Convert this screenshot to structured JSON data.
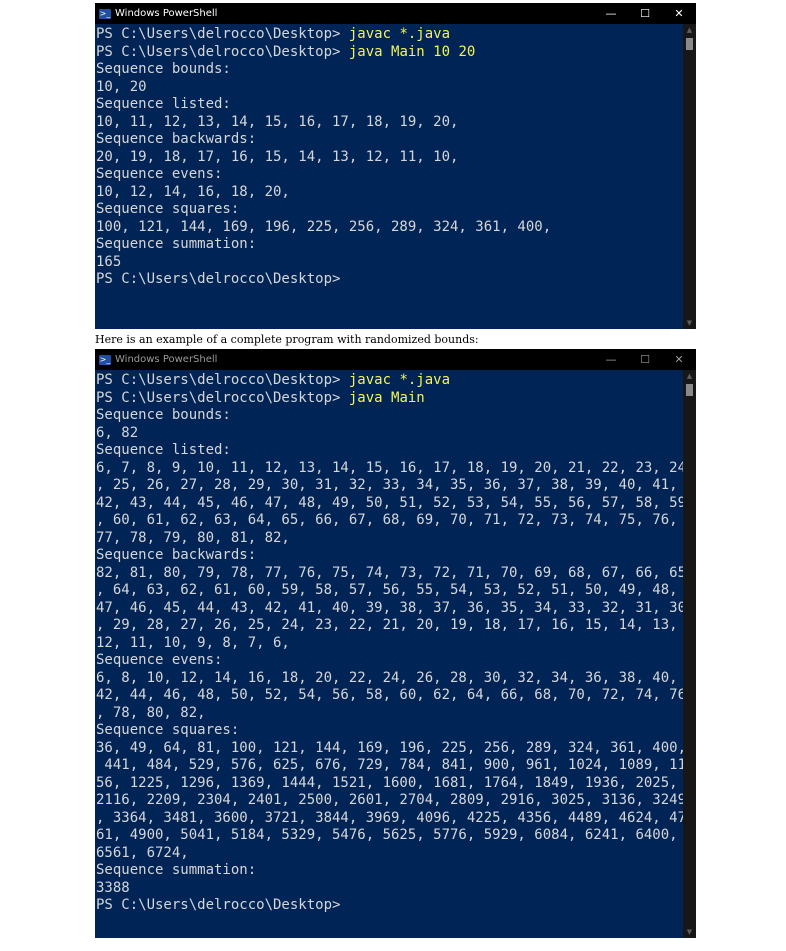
{
  "colors": {
    "console_bg": "#012456",
    "console_fg": "#d6d6d6",
    "command_fg": "#f5f552",
    "titlebar_bg": "#000000"
  },
  "window1": {
    "title": "Windows PowerShell",
    "icon": "powershell-icon",
    "controls": {
      "minimize": "—",
      "maximize": "☐",
      "close": "✕"
    },
    "lines": [
      {
        "prompt": "PS C:\\Users\\delrocco\\Desktop> ",
        "cmd": "javac *.java"
      },
      {
        "prompt": "PS C:\\Users\\delrocco\\Desktop> ",
        "cmd": "java Main 10 20"
      },
      {
        "text": "Sequence bounds:"
      },
      {
        "text": "10, 20"
      },
      {
        "text": "Sequence listed:"
      },
      {
        "text": "10, 11, 12, 13, 14, 15, 16, 17, 18, 19, 20,"
      },
      {
        "text": "Sequence backwards:"
      },
      {
        "text": "20, 19, 18, 17, 16, 15, 14, 13, 12, 11, 10,"
      },
      {
        "text": "Sequence evens:"
      },
      {
        "text": "10, 12, 14, 16, 18, 20,"
      },
      {
        "text": "Sequence squares:"
      },
      {
        "text": "100, 121, 144, 169, 196, 225, 256, 289, 324, 361, 400,"
      },
      {
        "text": "Sequence summation:"
      },
      {
        "text": "165"
      },
      {
        "text": "PS C:\\Users\\delrocco\\Desktop>"
      }
    ]
  },
  "caption": "Here is an example of a complete program with randomized bounds:",
  "window2": {
    "title": "Windows PowerShell",
    "icon": "powershell-icon",
    "controls": {
      "minimize": "—",
      "maximize": "☐",
      "close": "✕"
    },
    "lines": [
      {
        "prompt": "PS C:\\Users\\delrocco\\Desktop> ",
        "cmd": "javac *.java"
      },
      {
        "prompt": "PS C:\\Users\\delrocco\\Desktop> ",
        "cmd": "java Main"
      },
      {
        "text": "Sequence bounds:"
      },
      {
        "text": "6, 82"
      },
      {
        "text": "Sequence listed:"
      },
      {
        "text": "6, 7, 8, 9, 10, 11, 12, 13, 14, 15, 16, 17, 18, 19, 20, 21, 22, 23, 24"
      },
      {
        "text": ", 25, 26, 27, 28, 29, 30, 31, 32, 33, 34, 35, 36, 37, 38, 39, 40, 41,"
      },
      {
        "text": "42, 43, 44, 45, 46, 47, 48, 49, 50, 51, 52, 53, 54, 55, 56, 57, 58, 59"
      },
      {
        "text": ", 60, 61, 62, 63, 64, 65, 66, 67, 68, 69, 70, 71, 72, 73, 74, 75, 76,"
      },
      {
        "text": "77, 78, 79, 80, 81, 82,"
      },
      {
        "text": "Sequence backwards:"
      },
      {
        "text": "82, 81, 80, 79, 78, 77, 76, 75, 74, 73, 72, 71, 70, 69, 68, 67, 66, 65"
      },
      {
        "text": ", 64, 63, 62, 61, 60, 59, 58, 57, 56, 55, 54, 53, 52, 51, 50, 49, 48,"
      },
      {
        "text": "47, 46, 45, 44, 43, 42, 41, 40, 39, 38, 37, 36, 35, 34, 33, 32, 31, 30"
      },
      {
        "text": ", 29, 28, 27, 26, 25, 24, 23, 22, 21, 20, 19, 18, 17, 16, 15, 14, 13,"
      },
      {
        "text": "12, 11, 10, 9, 8, 7, 6,"
      },
      {
        "text": "Sequence evens:"
      },
      {
        "text": "6, 8, 10, 12, 14, 16, 18, 20, 22, 24, 26, 28, 30, 32, 34, 36, 38, 40,"
      },
      {
        "text": "42, 44, 46, 48, 50, 52, 54, 56, 58, 60, 62, 64, 66, 68, 70, 72, 74, 76"
      },
      {
        "text": ", 78, 80, 82,"
      },
      {
        "text": "Sequence squares:"
      },
      {
        "text": "36, 49, 64, 81, 100, 121, 144, 169, 196, 225, 256, 289, 324, 361, 400,"
      },
      {
        "text": " 441, 484, 529, 576, 625, 676, 729, 784, 841, 900, 961, 1024, 1089, 11"
      },
      {
        "text": "56, 1225, 1296, 1369, 1444, 1521, 1600, 1681, 1764, 1849, 1936, 2025,"
      },
      {
        "text": "2116, 2209, 2304, 2401, 2500, 2601, 2704, 2809, 2916, 3025, 3136, 3249"
      },
      {
        "text": ", 3364, 3481, 3600, 3721, 3844, 3969, 4096, 4225, 4356, 4489, 4624, 47"
      },
      {
        "text": "61, 4900, 5041, 5184, 5329, 5476, 5625, 5776, 5929, 6084, 6241, 6400,"
      },
      {
        "text": "6561, 6724,"
      },
      {
        "text": "Sequence summation:"
      },
      {
        "text": "3388"
      },
      {
        "text": "PS C:\\Users\\delrocco\\Desktop>"
      }
    ]
  }
}
